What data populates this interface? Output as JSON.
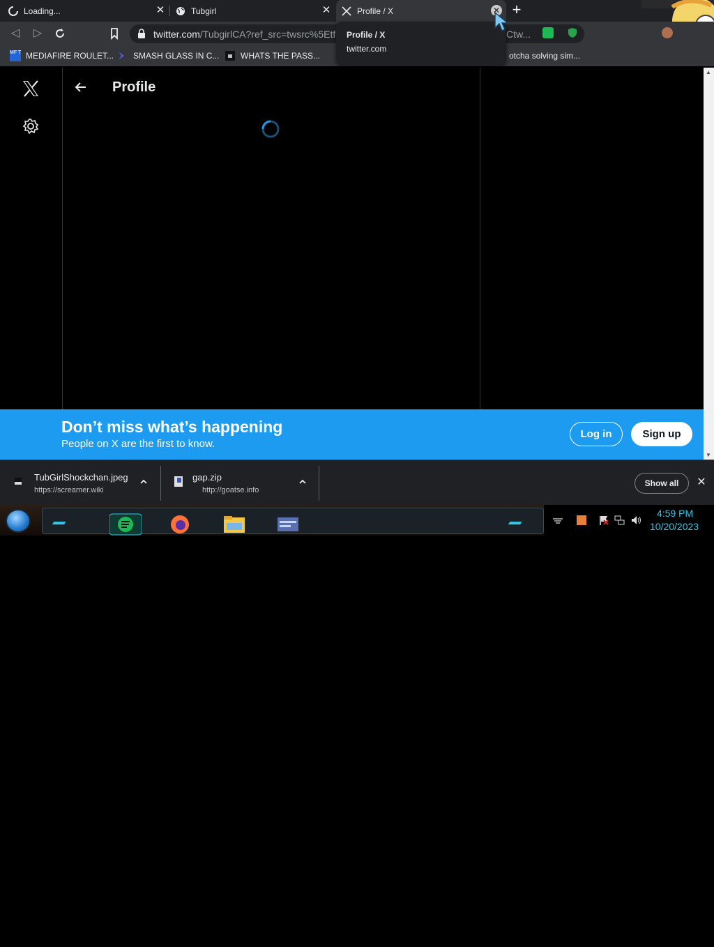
{
  "browser": {
    "tabs": [
      {
        "title": "Loading...",
        "icon": "loading-spinner-icon"
      },
      {
        "title": "Tubgirl",
        "icon": "globe-icon"
      },
      {
        "title": "Profile / X",
        "icon": "x-logo-icon",
        "active": true
      }
    ],
    "new_tab_icon": "plus-icon",
    "close_icon": "close-icon",
    "hover_card": {
      "title": "Profile / X",
      "domain": "twitter.com"
    },
    "url": {
      "host": "twitter.com",
      "rest": "/TubgirlCA?ref_src=twsrc%5Etf"
    },
    "omnibox_trailing_text": "Ctw...",
    "bookmarks": [
      {
        "label": "MEDIAFIRE ROULET...",
        "icon": "mediafire-icon"
      },
      {
        "label": "SMASH GLASS IN C...",
        "icon": "chevron-brand-icon"
      },
      {
        "label": "WHATS THE PASS...",
        "icon": "robot-icon"
      },
      {
        "label": "otcha solving sim...",
        "icon": "none"
      }
    ],
    "accent_color": "#1d9bf0"
  },
  "x_page": {
    "header_title": "Profile",
    "banner": {
      "headline": "Don’t miss what’s happening",
      "subline": "People on X are the first to know.",
      "login_label": "Log in",
      "signup_label": "Sign up"
    }
  },
  "downloads": {
    "items": [
      {
        "filename": "TubGirlShockchan.jpeg",
        "source": "https://screamer.wiki",
        "icon": "image-file-icon"
      },
      {
        "filename": "gap.zip",
        "source": "http://goatse.info",
        "icon": "zip-file-icon"
      }
    ],
    "show_all_label": "Show all"
  },
  "taskbar": {
    "time": "4:59 PM",
    "date": "10/20/2023",
    "apps": [
      "spotify-icon",
      "firefox-icon",
      "file-explorer-icon",
      "window-app-icon"
    ],
    "clock_color": "#35c6e8"
  }
}
